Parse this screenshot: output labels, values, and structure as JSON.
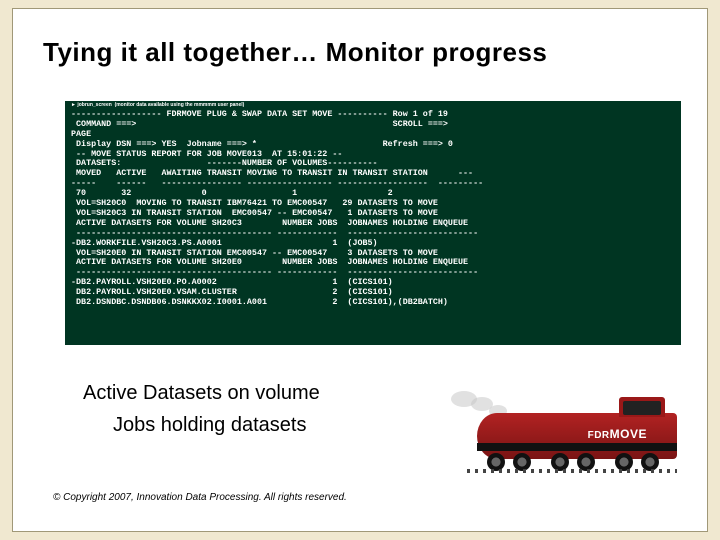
{
  "title": "Tying it all together… Monitor progress",
  "terminal": {
    "tiny_header": "► jobrun_screen  (monitor data available using the mmmmm user panel)",
    "lines": [
      "------------------ FDRMOVE PLUG & SWAP DATA SET MOVE ---------- Row 1 of 19",
      " COMMAND ===>                                                   SCROLL ===>",
      "PAGE",
      " Display DSN ===> YES  Jobname ===> *                         Refresh ===> 0",
      " -- MOVE STATUS REPORT FOR JOB MOVE013  AT 15:01:22 --",
      " DATASETS:                 -------NUMBER OF VOLUMES----------",
      " MOVED   ACTIVE   AWAITING TRANSIT MOVING TO TRANSIT IN TRANSIT STATION      ---",
      "-----    ------   ---------------- ----------------- ------------------  ---------",
      " 70       32              0                 1                  2",
      " VOL=SH20C0  MOVING TO TRANSIT IBM76421 TO EMC00547   29 DATASETS TO MOVE",
      " VOL=SH20C3 IN TRANSIT STATION  EMC00547 -- EMC00547   1 DATASETS TO MOVE",
      " ACTIVE DATASETS FOR VOLUME SH20C3        NUMBER JOBS  JOBNAMES HOLDING ENQUEUE",
      " --------------------------------------- ------------  --------------------------",
      "-DB2.WORKFILE.VSH20C3.PS.A0001                      1  (JOB5)",
      " VOL=SH20E0 IN TRANSIT STATION EMC00547 -- EMC00547    3 DATASETS TO MOVE",
      " ACTIVE DATASETS FOR VOLUME SH20E0        NUMBER JOBS  JOBNAMES HOLDING ENQUEUE",
      " --------------------------------------- ------------  --------------------------",
      "-DB2.PAYROLL.VSH20E0.PO.A0002                       1  (CICS101)",
      " DB2.PAYROLL.VSH20E0.VSAM.CLUSTER                   2  (CICS101)",
      " DB2.DSNDBC.DSNDB06.DSNKKX02.I0001.A001             2  (CICS101),(DB2BATCH)"
    ]
  },
  "caption_line1": "Active Datasets on volume",
  "caption_line2": "Jobs holding datasets",
  "train_brand_prefix": "FDR",
  "train_brand_suffix": "MOVE",
  "copyright": "© Copyright 2007, Innovation Data Processing. All rights reserved."
}
